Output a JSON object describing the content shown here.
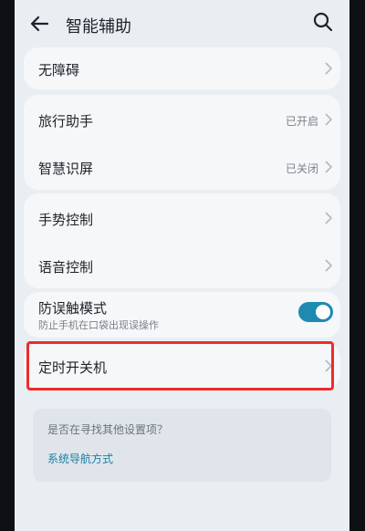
{
  "header": {
    "title": "智能辅助",
    "back_icon": "arrow-left-icon",
    "search_icon": "search-icon"
  },
  "sections": [
    {
      "items": [
        {
          "label": "无障碍",
          "status": ""
        }
      ]
    },
    {
      "items": [
        {
          "label": "旅行助手",
          "status": "已开启"
        },
        {
          "label": "智慧识屏",
          "status": "已关闭"
        }
      ]
    },
    {
      "items": [
        {
          "label": "手势控制",
          "status": ""
        },
        {
          "label": "语音控制",
          "status": ""
        }
      ]
    },
    {
      "items": [
        {
          "label": "防误触模式",
          "subtitle": "防止手机在口袋出现误操作",
          "toggle_on": true
        }
      ]
    },
    {
      "items": [
        {
          "label": "定时开关机",
          "status": ""
        }
      ]
    }
  ],
  "suggestion": {
    "question": "是否在寻找其他设置项？",
    "link": "系统导航方式"
  },
  "colors": {
    "accent": "#1e8ab0",
    "highlight": "#ef2b2b"
  }
}
